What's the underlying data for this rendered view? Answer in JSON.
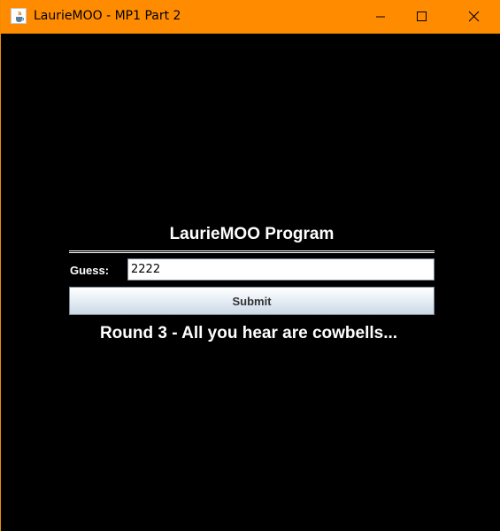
{
  "window": {
    "title": "LaurieMOO - MP1 Part 2",
    "titlebar_color": "#ff8c00",
    "icon": "java-cup-icon",
    "controls": [
      "minimize-icon",
      "maximize-icon",
      "close-icon"
    ]
  },
  "main": {
    "heading": "LaurieMOO Program",
    "guess_label": "Guess:",
    "guess_value": "2222",
    "submit_label": "Submit",
    "status_text": "Round 3 - All you hear are cowbells..."
  }
}
